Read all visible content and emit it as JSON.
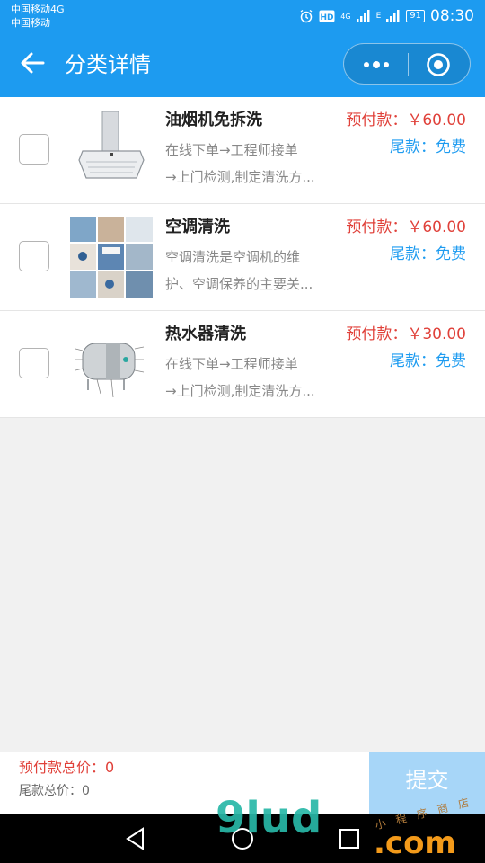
{
  "status_bar": {
    "carrier_line1": "中国移动4G",
    "carrier_line2": "中国移动",
    "net1": "4G",
    "net2": "E",
    "battery": "91",
    "time": "08:30"
  },
  "navbar": {
    "title": "分类详情",
    "bg_color": "#1d9bf0",
    "icons": [
      "back-arrow-icon",
      "more-dots-icon",
      "target-circle-icon"
    ]
  },
  "items": [
    {
      "name": "油烟机免拆洗",
      "desc_line1": "在线下单→工程师接单",
      "desc_line2": "→上门检测,制定清洗方...",
      "prepay": "预付款：￥60.00",
      "balance": "尾款：免费",
      "checked": false,
      "image": "range-hood-photo"
    },
    {
      "name": "空调清洗",
      "desc_line1": "空调清洗是空调机的维",
      "desc_line2": "护、空调保养的主要关...",
      "prepay": "预付款：￥60.00",
      "balance": "尾款：免费",
      "checked": false,
      "image": "air-conditioner-collage-photo"
    },
    {
      "name": "热水器清洗",
      "desc_line1": "在线下单→工程师接单",
      "desc_line2": "→上门检测,制定清洗方...",
      "prepay": "预付款：￥30.00",
      "balance": "尾款：免费",
      "checked": false,
      "image": "water-heater-diagram"
    }
  ],
  "footer": {
    "prepay_total": "预付款总价：0",
    "balance_total": "尾款总价：0",
    "submit": "提交",
    "submit_color": "#a7d6f8"
  },
  "system_nav": {
    "icons": [
      "back-triangle-icon",
      "home-circle-icon",
      "recent-square-icon"
    ]
  },
  "watermark": {
    "brand_main": "9lud",
    "brand_tld": ".com",
    "small_text": "小 程 序 商 店"
  },
  "colors": {
    "accent": "#1d9bf0",
    "price_red": "#e0413a"
  }
}
